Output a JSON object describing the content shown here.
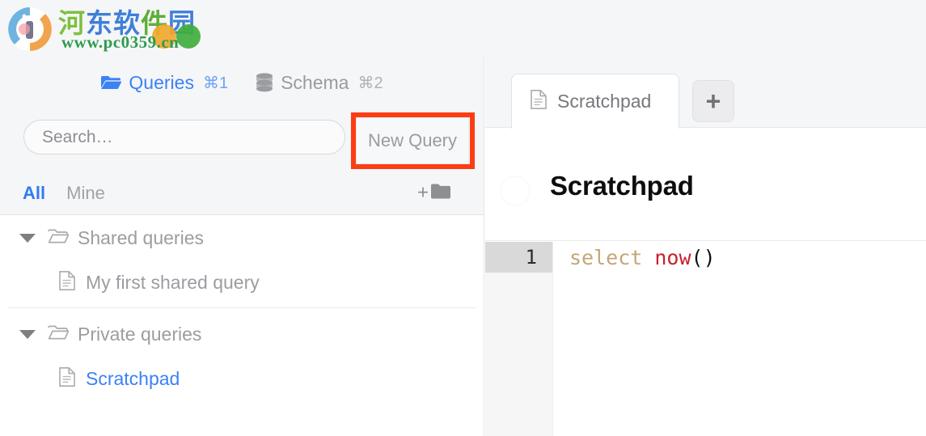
{
  "watermark": {
    "brand_chars": [
      "河",
      "东",
      "软",
      "件",
      "园"
    ],
    "url": "www.pc0359.cn",
    "logo_icon": "circular-logo-icon"
  },
  "sidebar": {
    "tabs": [
      {
        "label": "Queries",
        "shortcut": "⌘1",
        "icon": "folder-open-icon",
        "active": true
      },
      {
        "label": "Schema",
        "shortcut": "⌘2",
        "icon": "database-icon",
        "active": false
      }
    ],
    "search": {
      "placeholder": "Search…",
      "value": "",
      "icon": "search-input"
    },
    "new_query_button": {
      "label": "New Query"
    },
    "filters": [
      {
        "label": "All",
        "active": true
      },
      {
        "label": "Mine",
        "active": false
      }
    ],
    "new_folder_button": {
      "plus": "+",
      "icon": "folder-icon"
    },
    "tree": [
      {
        "folder": "Shared queries",
        "expanded": true,
        "items": [
          {
            "label": "My first shared query",
            "selected": false,
            "icon": "document-icon"
          }
        ]
      },
      {
        "folder": "Private queries",
        "expanded": true,
        "items": [
          {
            "label": "Scratchpad",
            "selected": true,
            "icon": "document-icon"
          }
        ]
      }
    ]
  },
  "main": {
    "tabs": [
      {
        "label": "Scratchpad",
        "icon": "document-icon",
        "active": true
      }
    ],
    "add_tab_button": {
      "label": "+"
    },
    "document": {
      "title": "Scratchpad"
    },
    "editor": {
      "lines": [
        {
          "number": "1",
          "active": true,
          "tokens": [
            {
              "text": "select",
              "type": "keyword"
            },
            {
              "text": " ",
              "type": "plain"
            },
            {
              "text": "now",
              "type": "function"
            },
            {
              "text": "()",
              "type": "punctuation"
            }
          ]
        }
      ]
    }
  },
  "annotation": {
    "type": "red-highlight-rectangle",
    "target": "New Query",
    "color": "#fc3d14"
  },
  "colors": {
    "accent_blue": "#3b82f6",
    "muted_text": "#9b9da1",
    "panel_bg": "#f5f6f7",
    "keyword": "#c4a678",
    "function": "#c9202e",
    "annotation_red": "#fc3d14"
  }
}
